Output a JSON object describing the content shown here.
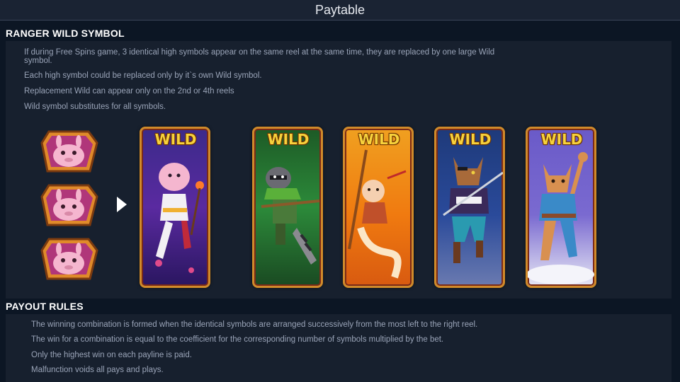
{
  "window": {
    "title": "Paytable"
  },
  "ranger": {
    "heading": "RANGER WILD SYMBOL",
    "lines": [
      "If during Free Spins game, 3 identical high symbols appear on the same reel at the same time, they are replaced by one large Wild",
      "symbol.",
      "Each high symbol could be replaced only by it`s own Wild symbol.",
      "Replacement Wild can appear only on the 2nd or 4th reels",
      "Wild symbol substitutes for all symbols."
    ],
    "wild_label": "WILD",
    "cards": [
      {
        "icon": "alpaca-wild-icon",
        "bg": "#5a2aa0"
      },
      {
        "icon": "raccoon-wild-icon",
        "bg": "#1f7a2a"
      },
      {
        "icon": "monkey-wild-icon",
        "bg": "#f07a10"
      },
      {
        "icon": "wolf-wild-icon",
        "bg": "#2a4a9a"
      },
      {
        "icon": "lynx-wild-icon",
        "bg": "#7a6ad0"
      }
    ],
    "high_symbols": [
      "alpaca-symbol-icon",
      "alpaca-symbol-icon",
      "alpaca-symbol-icon"
    ]
  },
  "payout": {
    "heading": "PAYOUT RULES",
    "lines": [
      "The winning combination is formed when the identical symbols are arranged successively from the most left to the right reel.",
      "The win for a combination is equal to the coefficient for the corresponding number of symbols multiplied by the bet.",
      "Only the highest win on each payline is paid.",
      "Malfunction voids all pays and plays."
    ]
  }
}
